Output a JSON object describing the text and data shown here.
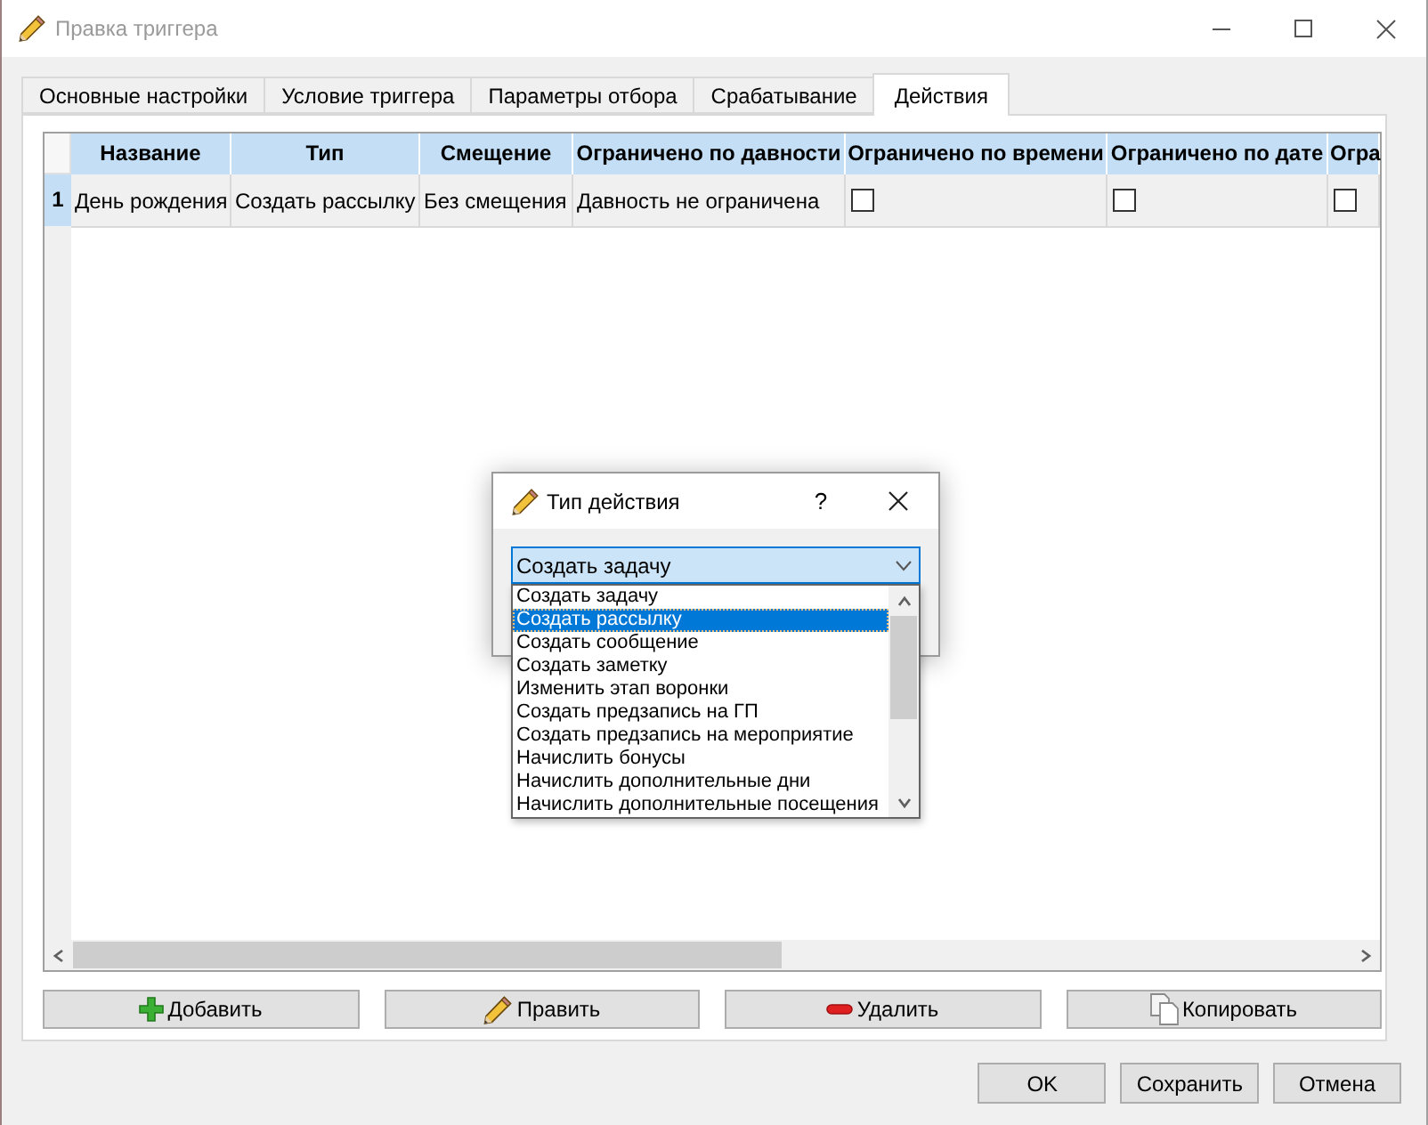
{
  "window": {
    "title": "Правка триггера"
  },
  "tabs": [
    {
      "label": "Основные настройки",
      "selected": false
    },
    {
      "label": "Условие триггера",
      "selected": false
    },
    {
      "label": "Параметры отбора",
      "selected": false
    },
    {
      "label": "Срабатывание",
      "selected": false
    },
    {
      "label": "Действия",
      "selected": true
    }
  ],
  "table": {
    "columns": [
      "Название",
      "Тип",
      "Смещение",
      "Ограничено по давности",
      "Ограничено по времени",
      "Ограничено по дате",
      "Огра"
    ],
    "rows": [
      {
        "number": "1",
        "cells": [
          {
            "kind": "text",
            "text": "День рождения"
          },
          {
            "kind": "text",
            "text": "Создать рассылку"
          },
          {
            "kind": "text",
            "text": "Без смещения"
          },
          {
            "kind": "text",
            "text": "Давность не ограничена"
          },
          {
            "kind": "checkbox",
            "checked": false
          },
          {
            "kind": "checkbox",
            "checked": false
          },
          {
            "kind": "checkbox",
            "checked": false
          }
        ]
      }
    ]
  },
  "actions": [
    {
      "kind": "add",
      "label": "Добавить"
    },
    {
      "kind": "edit",
      "label": "Править"
    },
    {
      "kind": "delete",
      "label": "Удалить"
    },
    {
      "kind": "copy",
      "label": "Копировать"
    }
  ],
  "footer_buttons": [
    "OK",
    "Сохранить",
    "Отмена"
  ],
  "dialog": {
    "title": "Тип действия",
    "help": "?",
    "combo": {
      "value": "Создать задачу",
      "expanded": true
    },
    "options": [
      {
        "label": "Создать задачу",
        "selected": false
      },
      {
        "label": "Создать рассылку",
        "selected": true
      },
      {
        "label": "Создать сообщение",
        "selected": false
      },
      {
        "label": "Создать заметку",
        "selected": false
      },
      {
        "label": "Изменить этап воронки",
        "selected": false
      },
      {
        "label": "Создать предзапись на ГП",
        "selected": false
      },
      {
        "label": "Создать предзапись на мероприятие",
        "selected": false
      },
      {
        "label": "Начислить бонусы",
        "selected": false
      },
      {
        "label": "Начислить дополнительные дни",
        "selected": false
      },
      {
        "label": "Начислить дополнительные посещения",
        "selected": false
      }
    ]
  }
}
